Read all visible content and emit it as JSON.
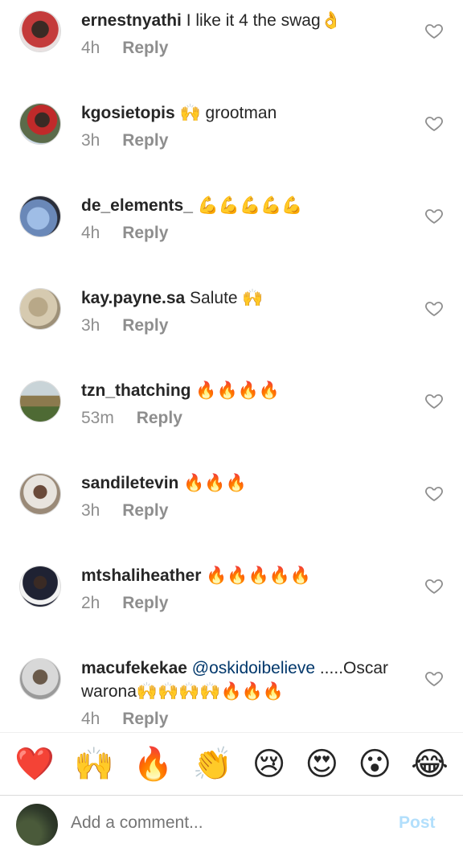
{
  "comments": [
    {
      "username": "ernestnyathi",
      "text": "I like it 4 the swag👌",
      "mention": "",
      "time": "4h",
      "reply": "Reply",
      "avatar_color": "#c43b3b"
    },
    {
      "username": "kgosietopis",
      "text": "🙌 grootman",
      "mention": "",
      "time": "3h",
      "reply": "Reply",
      "avatar_color": "#4b4b6b"
    },
    {
      "username": "de_elements_",
      "text": "💪💪💪💪💪",
      "mention": "",
      "time": "4h",
      "reply": "Reply",
      "avatar_color": "#7fa0cf"
    },
    {
      "username": "kay.payne.sa",
      "text": "Salute 🙌",
      "mention": "",
      "time": "3h",
      "reply": "Reply",
      "avatar_color": "#c7b79a"
    },
    {
      "username": "tzn_thatching",
      "text": "🔥🔥🔥🔥",
      "mention": "",
      "time": "53m",
      "reply": "Reply",
      "avatar_color": "#8c7a4e"
    },
    {
      "username": "sandiletevin",
      "text": "🔥🔥🔥",
      "mention": "",
      "time": "3h",
      "reply": "Reply",
      "avatar_color": "#b0a89a"
    },
    {
      "username": "mtshaliheather",
      "text": "🔥🔥🔥🔥🔥",
      "mention": "",
      "time": "2h",
      "reply": "Reply",
      "avatar_color": "#1f2233"
    },
    {
      "username": "macufekekae",
      "mention": "@oskidoibelieve",
      "text": " .....Oscar warona🙌🙌🙌🙌🔥🔥🔥",
      "time": "4h",
      "reply": "Reply",
      "avatar_color": "#9a9a9a"
    }
  ],
  "quick_reactions": [
    "❤️",
    "🙌",
    "🔥",
    "👏",
    "😢",
    "😍",
    "😮",
    "😂"
  ],
  "composer": {
    "placeholder": "Add a comment...",
    "post_label": "Post"
  }
}
